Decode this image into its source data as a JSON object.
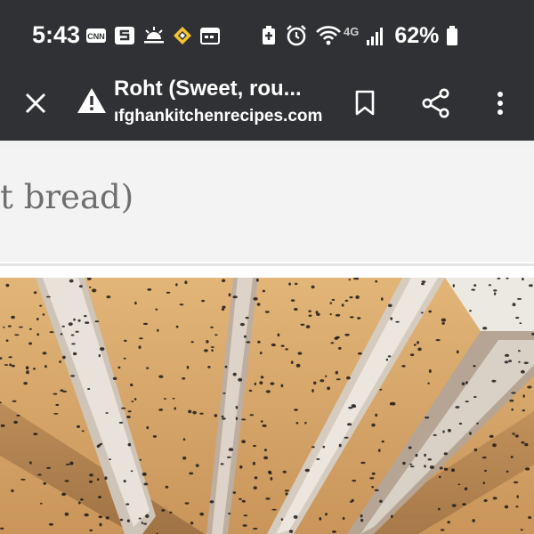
{
  "status_bar": {
    "time": "5:43",
    "battery_percent": "62%",
    "network_label": "4G",
    "icons": [
      "cnn-icon",
      "s-app-icon",
      "weather-sunrise-icon",
      "diamond-nav-icon",
      "calendar-icon",
      "battery-saver-icon",
      "alarm-icon",
      "wifi-icon",
      "signal-icon",
      "battery-icon"
    ]
  },
  "toolbar": {
    "page_title": "Roht (Sweet, rou...",
    "page_url": "ıfghankitchenrecipes.com",
    "security_icon": "warning-icon",
    "icons": [
      "close-icon",
      "bookmark-icon",
      "share-icon",
      "more-vert-icon"
    ]
  },
  "content": {
    "heading": "at bread)",
    "image_alt": "Sliced sweet round bread topped with nigella seeds"
  },
  "colors": {
    "chrome_bg": "#303134",
    "chrome_fg": "#ffffff",
    "heading_band": "#f3f3f3",
    "heading_text": "#6f6f6f",
    "bread": "#d6a468"
  }
}
